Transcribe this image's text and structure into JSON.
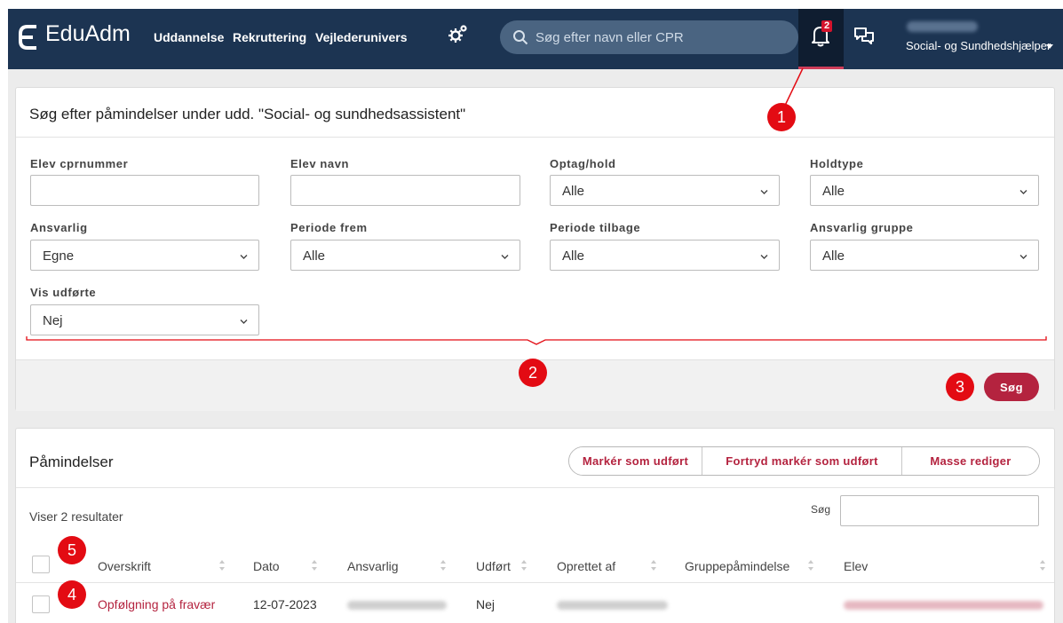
{
  "header": {
    "logo_text": "EduAdm",
    "nav": [
      "Uddannelse",
      "Rekruttering",
      "Vejlederunivers"
    ],
    "search_placeholder": "Søg efter navn eller CPR",
    "notification_count": "2",
    "user_name": "",
    "role": "Social- og Sundhedshjælper",
    "active_accent_color": "#cf3d59"
  },
  "filter_panel": {
    "title": "Søg efter påmindelser under udd. \"Social- og sundhedsassistent\"",
    "fields": {
      "cpr": {
        "label": "Elev cprnummer",
        "value": ""
      },
      "navn": {
        "label": "Elev navn",
        "value": ""
      },
      "optag": {
        "label": "Optag/hold",
        "value": "Alle"
      },
      "holdtype": {
        "label": "Holdtype",
        "value": "Alle"
      },
      "ansvarlig": {
        "label": "Ansvarlig",
        "value": "Egne"
      },
      "periode_frem": {
        "label": "Periode frem",
        "value": "Alle"
      },
      "periode_tilbage": {
        "label": "Periode tilbage",
        "value": "Alle"
      },
      "ansvarlig_gruppe": {
        "label": "Ansvarlig gruppe",
        "value": "Alle"
      },
      "vis_udforte": {
        "label": "Vis udførte",
        "value": "Nej"
      }
    },
    "search_button": "Søg",
    "button_color": "#b4233f"
  },
  "markers": [
    "1",
    "2",
    "3",
    "4",
    "5"
  ],
  "reminders": {
    "title": "Påmindelser",
    "actions": [
      "Markér som udført",
      "Fortryd markér som udført",
      "Masse rediger"
    ],
    "result_count": "Viser 2 resultater",
    "search_label": "Søg",
    "columns": [
      "Overskrift",
      "Dato",
      "Ansvarlig",
      "Udført",
      "Oprettet af",
      "Gruppepåmindelse",
      "Elev"
    ],
    "rows": [
      {
        "overskrift": "Opfølgning på fravær",
        "dato": "12-07-2023",
        "ansvarlig": "",
        "udfort": "Nej",
        "oprettet_af": "",
        "gruppe": "",
        "elev": ""
      }
    ]
  }
}
